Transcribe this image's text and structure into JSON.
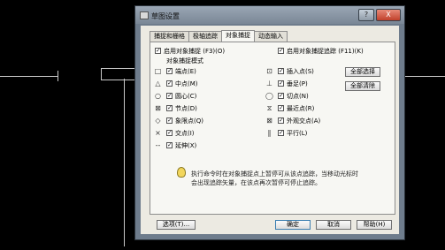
{
  "dialog": {
    "title": "草图设置",
    "help_glyph": "?",
    "close_glyph": "X"
  },
  "tabs": [
    {
      "label": "捕捉和栅格"
    },
    {
      "label": "极轴追踪"
    },
    {
      "label": "对象捕捉"
    },
    {
      "label": "动态输入"
    }
  ],
  "options": {
    "enable_osnap": "启用对象捕捉 (F3)(O)",
    "enable_tracking": "启用对象捕捉追踪 (F11)(K)",
    "group_label": "对象捕捉模式"
  },
  "modes_left": [
    {
      "icon": "square-endpoint-icon",
      "glyph": "□",
      "label": "端点(E)"
    },
    {
      "icon": "triangle-midpoint-icon",
      "glyph": "△",
      "label": "中点(M)"
    },
    {
      "icon": "circle-center-icon",
      "glyph": "○",
      "label": "圆心(C)"
    },
    {
      "icon": "node-icon",
      "glyph": "⊠",
      "label": "节点(D)"
    },
    {
      "icon": "diamond-quadrant-icon",
      "glyph": "◇",
      "label": "象限点(Q)"
    },
    {
      "icon": "x-intersection-icon",
      "glyph": "×",
      "label": "交点(I)"
    },
    {
      "icon": "extension-icon",
      "glyph": "--",
      "label": "延伸(X)"
    }
  ],
  "modes_right": [
    {
      "icon": "insertion-icon",
      "glyph": "⊡",
      "label": "插入点(S)"
    },
    {
      "icon": "perpendicular-icon",
      "glyph": "⊥",
      "label": "垂足(P)"
    },
    {
      "icon": "tangent-icon",
      "glyph": "◯",
      "label": "切点(N)"
    },
    {
      "icon": "nearest-icon",
      "glyph": "⧖",
      "label": "最近点(R)"
    },
    {
      "icon": "apparent-intersection-icon",
      "glyph": "⊠",
      "label": "外观交点(A)"
    },
    {
      "icon": "parallel-icon",
      "glyph": "∥",
      "label": "平行(L)"
    }
  ],
  "buttons": {
    "select_all": "全部选择",
    "clear_all": "全部清除",
    "options": "选项(T)...",
    "ok": "确定",
    "cancel": "取消",
    "help": "帮助(H)"
  },
  "info_text": {
    "line1": "执行命令时在对象捕捉点上暂停可从该点追踪，当移动光标时",
    "line2": "会出现追踪矢量，在该点再次暂停可停止追踪。"
  }
}
